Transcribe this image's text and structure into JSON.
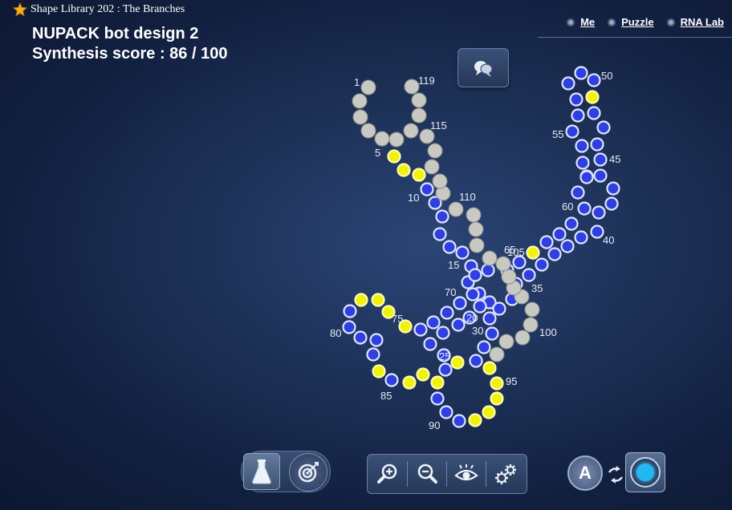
{
  "header": {
    "breadcrumb": "Shape Library 202 : The Branches",
    "design_title": "NUPACK bot design 2",
    "score_line": "Synthesis score : 86 / 100"
  },
  "nav": [
    {
      "label": "Me"
    },
    {
      "label": "Puzzle"
    },
    {
      "label": "RNA Lab"
    }
  ],
  "colors": {
    "gray": "#c9c9c4",
    "blue": "#2f3fe0",
    "yellow": "#f1f209"
  },
  "toolbar": {
    "left": [
      "flask-icon",
      "target-icon"
    ],
    "middle": [
      "zoom-in-icon",
      "zoom-out-icon",
      "eye-icon",
      "gears-icon"
    ],
    "right": [
      "letter-a-icon",
      "swap-icon",
      "circle-mode-icon"
    ],
    "letter_a": "A"
  },
  "rna": {
    "sequence_colors": "GGGGGYYYBBBBBBBBBBBBBBBBBYBBBBBBBBBBBBBBBBBBBBBBYBBBBBBBBBBBBBBYBBBBBBBBBYYYYBBBBBYBYYYBBBYYYYYGGGGGGGGGGGGGGGGGGGGGGGG",
    "length": 120,
    "labels": [
      {
        "n": 1,
        "text": "1"
      },
      {
        "n": 5,
        "text": "5"
      },
      {
        "n": 10,
        "text": "10"
      },
      {
        "n": 15,
        "text": "15"
      },
      {
        "n": 20,
        "text": "20"
      },
      {
        "n": 25,
        "text": "25"
      },
      {
        "n": 30,
        "text": "30"
      },
      {
        "n": 35,
        "text": "35"
      },
      {
        "n": 40,
        "text": "40"
      },
      {
        "n": 45,
        "text": "45"
      },
      {
        "n": 50,
        "text": "50"
      },
      {
        "n": 55,
        "text": "55"
      },
      {
        "n": 60,
        "text": "60"
      },
      {
        "n": 65,
        "text": "65"
      },
      {
        "n": 70,
        "text": "70"
      },
      {
        "n": 75,
        "text": "75"
      },
      {
        "n": 80,
        "text": "80"
      },
      {
        "n": 85,
        "text": "85"
      },
      {
        "n": 90,
        "text": "90"
      },
      {
        "n": 95,
        "text": "95"
      },
      {
        "n": 100,
        "text": "100"
      },
      {
        "n": 105,
        "text": "105"
      },
      {
        "n": 110,
        "text": "110"
      },
      {
        "n": 115,
        "text": "115"
      },
      {
        "n": 119,
        "text": "119"
      }
    ]
  }
}
